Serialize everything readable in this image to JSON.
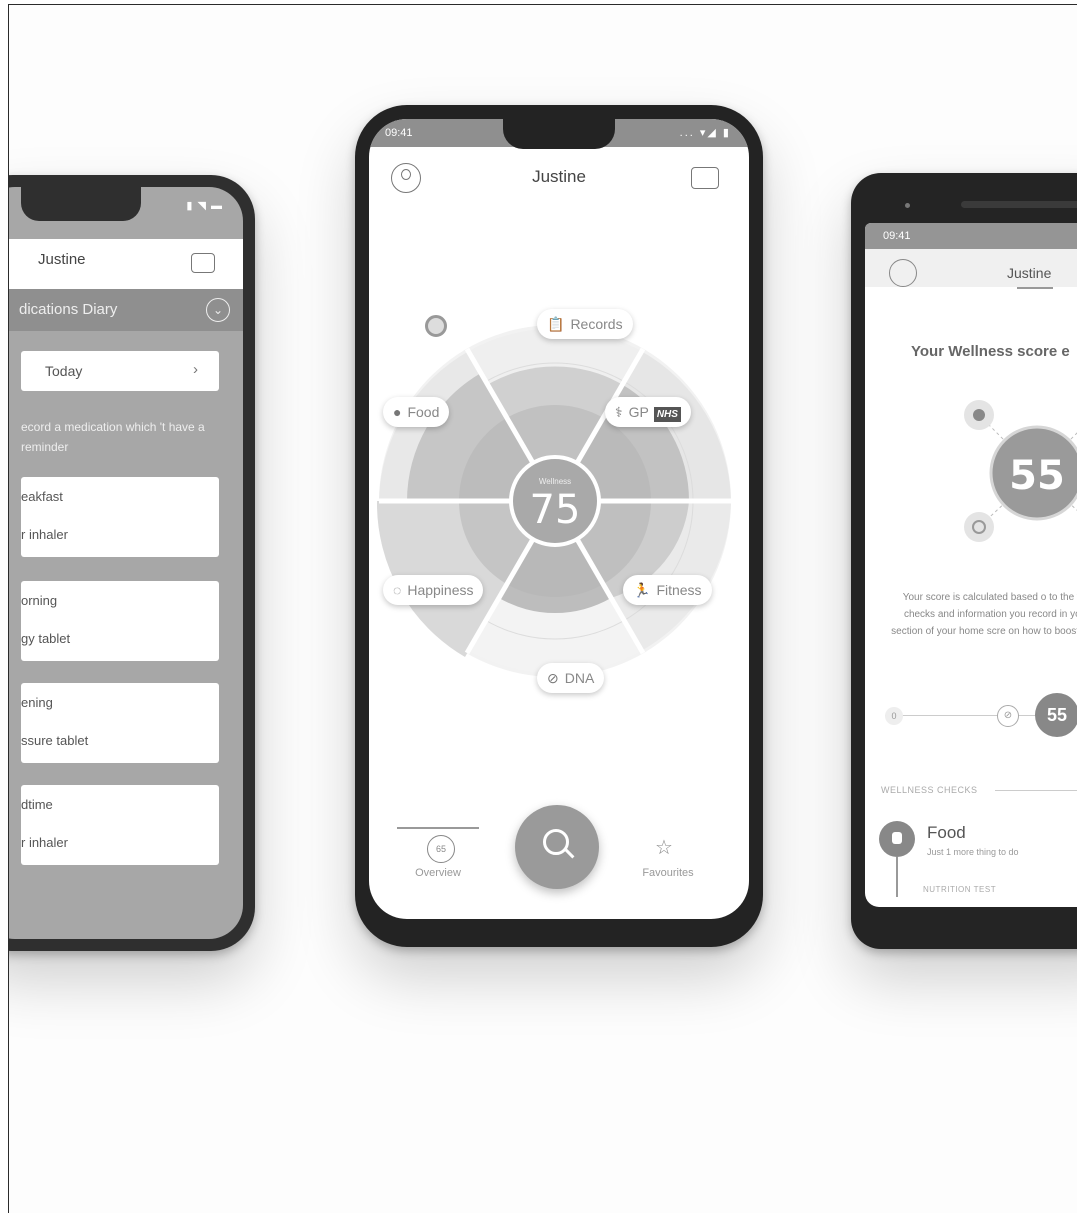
{
  "left_phone": {
    "title": "Justine",
    "diary_label": "dications Diary",
    "today_label": "Today",
    "note": "ecord a medication which 't have a reminder",
    "entries": [
      {
        "time": "eakfast",
        "med": "r inhaler"
      },
      {
        "time": "orning",
        "med": "gy tablet"
      },
      {
        "time": "ening",
        "med": "ssure tablet"
      },
      {
        "time": "dtime",
        "med": "r inhaler"
      }
    ]
  },
  "center_phone": {
    "status_time": "09:41",
    "title": "Justine",
    "wellness_label": "Wellness",
    "wellness_score": "75",
    "categories": {
      "records": "Records",
      "food": "Food",
      "gp": "GP",
      "nhs": "NHS",
      "happiness": "Happiness",
      "fitness": "Fitness",
      "dna": "DNA"
    },
    "tabs": {
      "overview_badge": "65",
      "overview": "Overview",
      "favourites": "Favourites"
    }
  },
  "right_phone": {
    "status_time": "09:41",
    "title": "Justine",
    "heading": "Your Wellness score e",
    "score": "55",
    "description": "Your score is calculated based o to the wellness checks and information you record in your each section of your home scre on how to boost your welln",
    "slider_start": "0",
    "slider_knob": "55",
    "checks_label": "WELLNESS CHECKS",
    "food_title": "Food",
    "food_subtitle": "Just 1 more thing to do",
    "nutrition_label": "NUTRITION TEST"
  },
  "colors": {
    "screen_gray": "#a7a7a7",
    "accent_gray": "#8f8f8f",
    "phone_body": "#2f2f2f"
  }
}
